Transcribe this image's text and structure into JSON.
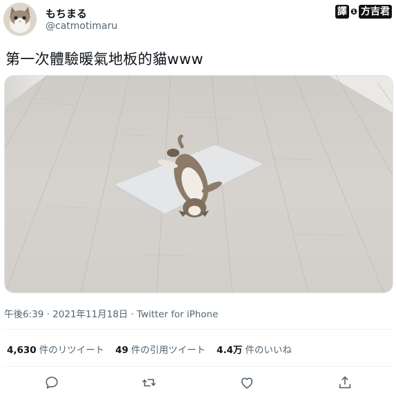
{
  "author": {
    "display_name": "もちまる",
    "handle": "@catmotimaru"
  },
  "badge": {
    "part1": "譯",
    "part2": "方吉君"
  },
  "tweet": {
    "text": "第一次體驗暖氣地板的貓www",
    "image_icon": "cat-on-floor-photo"
  },
  "meta": {
    "time": "午後6:39",
    "sep1": " · ",
    "date": "2021年11月18日",
    "sep2": " · ",
    "source": "Twitter for iPhone"
  },
  "stats": [
    {
      "count": "4,630",
      "label": "件のリツイート"
    },
    {
      "count": "49",
      "label": "件の引用ツイート"
    },
    {
      "count": "4.4万",
      "label": "件のいいね"
    }
  ],
  "actions": [
    "reply-icon",
    "retweet-icon",
    "like-icon",
    "share-icon"
  ],
  "colors": {
    "text_primary": "#0f1419",
    "text_secondary": "#536471",
    "divider": "#eff3f4",
    "icon": "#536471"
  }
}
